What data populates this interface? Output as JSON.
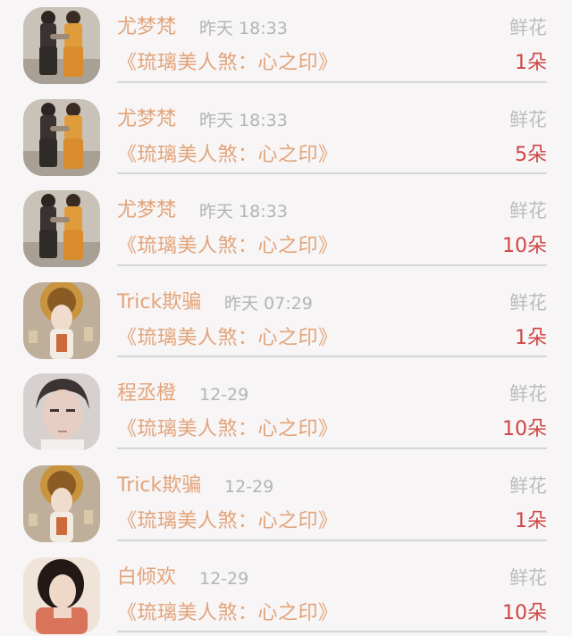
{
  "gift_list": [
    {
      "name": "尤梦梵",
      "time": "昨天 18:33",
      "gift_type": "鲜花",
      "title": "《琉璃美人煞：心之印》",
      "count": "1朵",
      "avatar_icon": "couple-walking-avatar"
    },
    {
      "name": "尤梦梵",
      "time": "昨天 18:33",
      "gift_type": "鲜花",
      "title": "《琉璃美人煞：心之印》",
      "count": "5朵",
      "avatar_icon": "couple-walking-avatar"
    },
    {
      "name": "尤梦梵",
      "time": "昨天 18:33",
      "gift_type": "鲜花",
      "title": "《琉璃美人煞：心之印》",
      "count": "10朵",
      "avatar_icon": "couple-walking-avatar"
    },
    {
      "name": "Trick欺骗",
      "time": "昨天 07:29",
      "gift_type": "鲜花",
      "title": "《琉璃美人煞：心之印》",
      "count": "1朵",
      "avatar_icon": "costume-woman-avatar"
    },
    {
      "name": "程丞橙",
      "time": "12-29",
      "gift_type": "鲜花",
      "title": "《琉璃美人煞：心之印》",
      "count": "10朵",
      "avatar_icon": "man-portrait-avatar"
    },
    {
      "name": "Trick欺骗",
      "time": "12-29",
      "gift_type": "鲜花",
      "title": "《琉璃美人煞：心之印》",
      "count": "1朵",
      "avatar_icon": "costume-woman-avatar"
    },
    {
      "name": "白倾欢",
      "time": "12-29",
      "gift_type": "鲜花",
      "title": "《琉璃美人煞：心之印》",
      "count": "10朵",
      "avatar_icon": "woman-portrait-avatar"
    }
  ],
  "colors": {
    "name": "#e3a47a",
    "time": "#b4b4b4",
    "gift_type": "#bdbdbd",
    "count": "#d14545",
    "divider": "#d6d6d6",
    "background": "#f7f5f6"
  }
}
